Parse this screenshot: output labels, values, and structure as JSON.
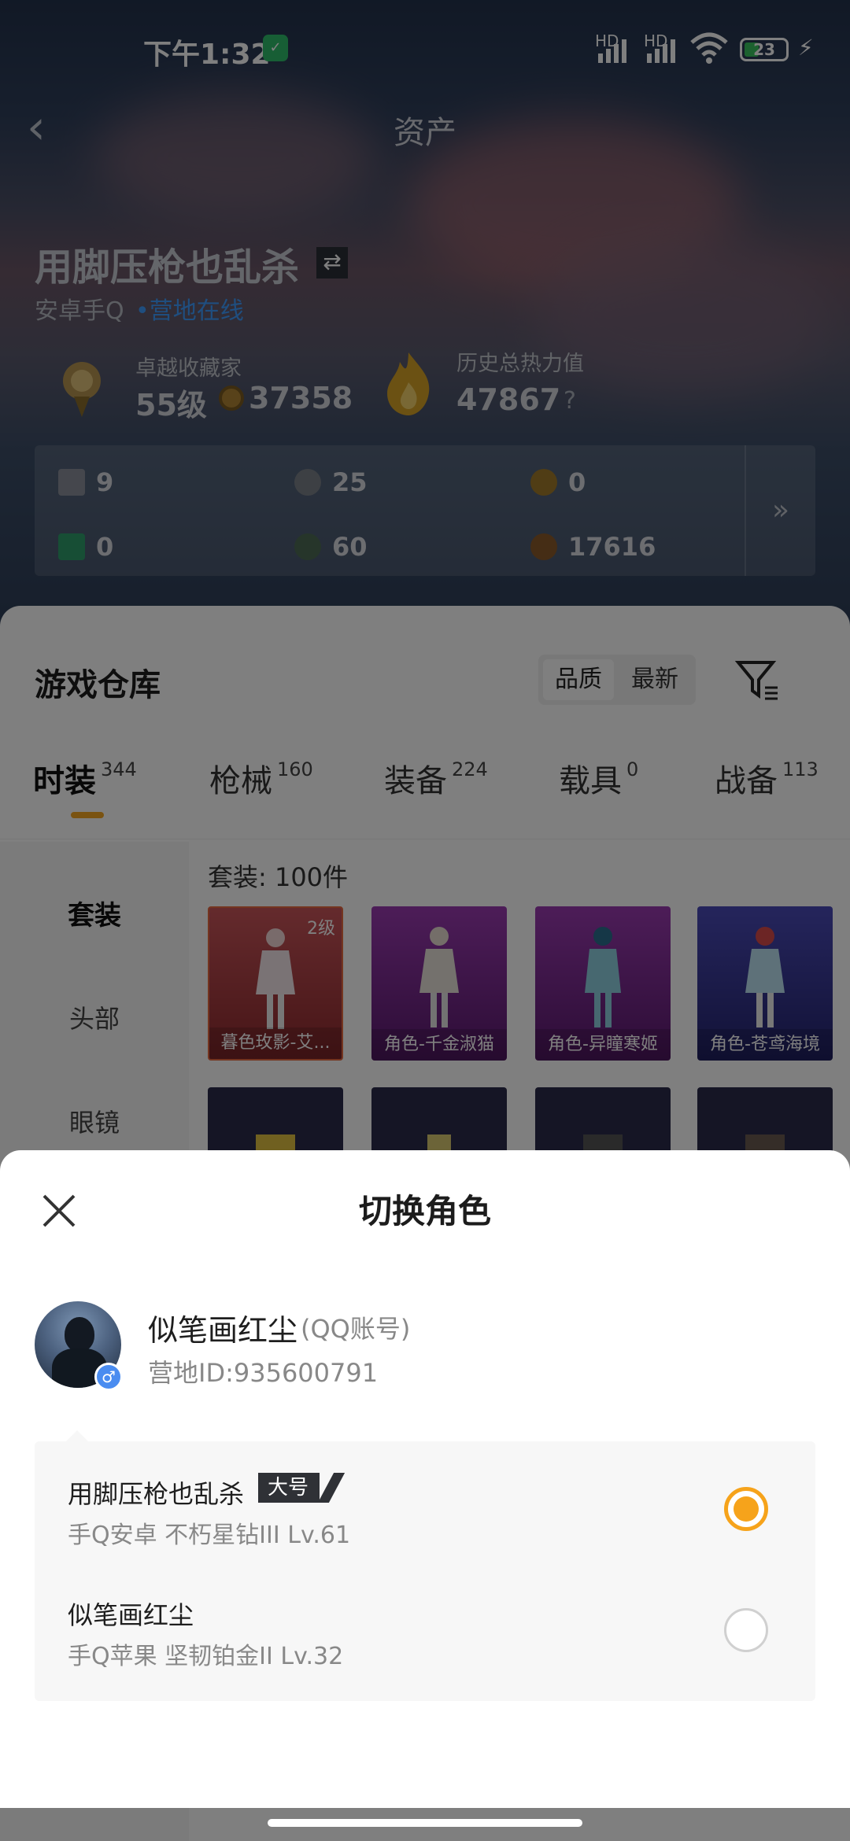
{
  "status_bar": {
    "time": "下午1:32",
    "signal1": "HD",
    "signal2": "HD",
    "battery": "23"
  },
  "header": {
    "title": "资产",
    "back_icon": "chevron-left-icon"
  },
  "profile": {
    "name": "用脚压枪也乱杀",
    "platform": "安卓手Q",
    "online_status": "•营地在线",
    "collector_title": "卓越收藏家",
    "collector_level": "55级",
    "collector_score": "37358",
    "heat_title": "历史总热力值",
    "heat_value": "47867",
    "help": "?"
  },
  "resources": [
    {
      "value": "9",
      "icon": "card-icon",
      "color": "#8a8f9a"
    },
    {
      "value": "25",
      "icon": "silver-coin-icon",
      "color": "#7b8089"
    },
    {
      "value": "0",
      "icon": "gold-medal-icon",
      "color": "#a07a2a"
    },
    {
      "value": "0",
      "icon": "green-card-icon",
      "color": "#2f9d6a"
    },
    {
      "value": "60",
      "icon": "green-orb-icon",
      "color": "#4c6b55"
    },
    {
      "value": "17616",
      "icon": "bronze-coin-icon",
      "color": "#8a5a2a"
    }
  ],
  "resources_more": "»",
  "warehouse": {
    "title": "游戏仓库",
    "sort_quality": "品质",
    "sort_newest": "最新",
    "tabs": [
      {
        "label": "时装",
        "count": "344"
      },
      {
        "label": "枪械",
        "count": "160"
      },
      {
        "label": "装备",
        "count": "224"
      },
      {
        "label": "载具",
        "count": "0"
      },
      {
        "label": "战备",
        "count": "113"
      }
    ],
    "sidebar": [
      "套装",
      "头部",
      "眼镜"
    ],
    "grid_title": "套装: 100件",
    "cards": [
      {
        "label": "暮色玫影-艾...",
        "level": "2级",
        "color": "#b63a3a"
      },
      {
        "label": "角色-千金淑猫",
        "level": "",
        "color": "#7a2a8e"
      },
      {
        "label": "角色-异瞳寒姬",
        "level": "",
        "color": "#7a2a8e"
      },
      {
        "label": "角色-苍鸢海境",
        "level": "",
        "color": "#3a3aa0"
      }
    ]
  },
  "modal": {
    "title": "切换角色",
    "account_name": "似笔画红尘",
    "account_type": "(QQ账号)",
    "account_id": "营地ID:935600791",
    "gender": "♂",
    "roles": [
      {
        "name": "用脚压枪也乱杀",
        "badge": "大号",
        "info": "手Q安卓   不朽星钻III   Lv.61",
        "selected": true
      },
      {
        "name": "似笔画红尘",
        "badge": "",
        "info": "手Q苹果   坚韧铂金II   Lv.32",
        "selected": false
      }
    ]
  }
}
